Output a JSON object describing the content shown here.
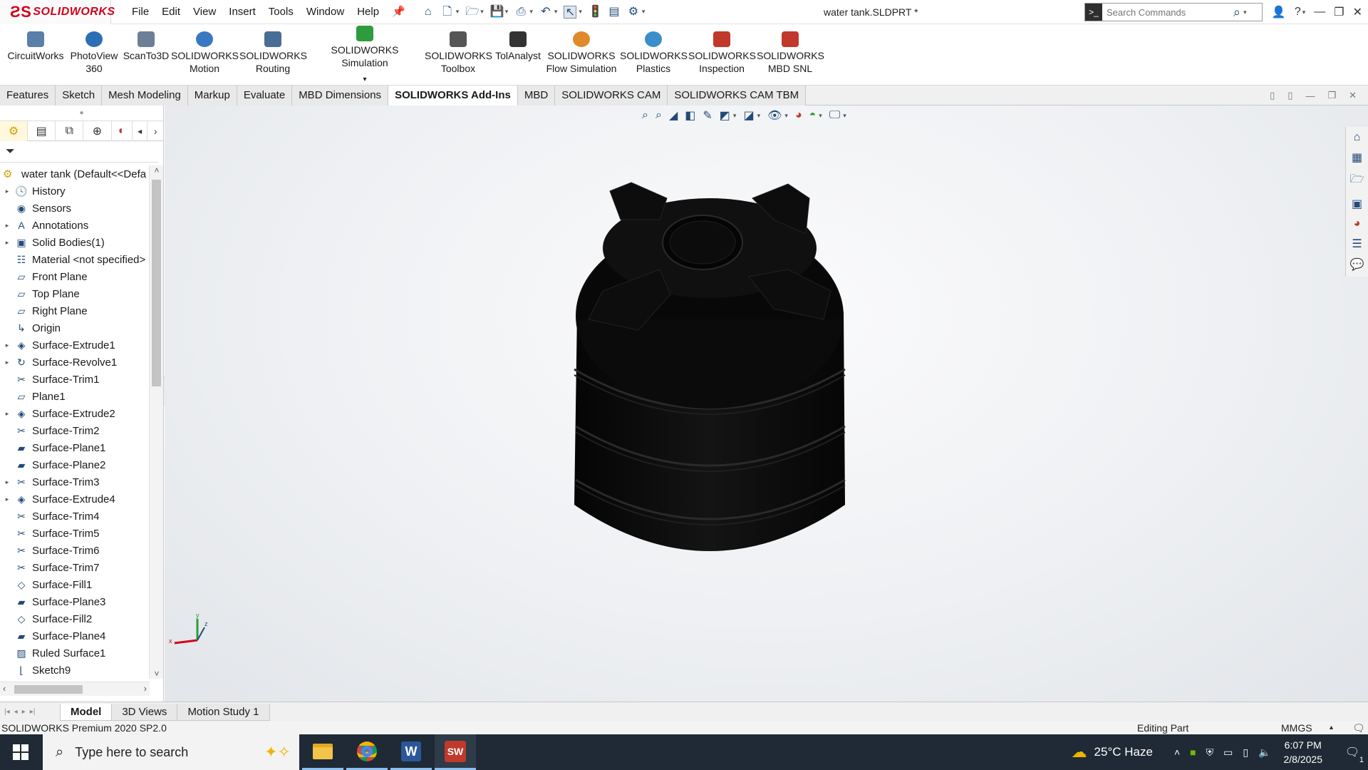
{
  "app": {
    "brand": "SOLIDWORKS",
    "document_title": "water tank.SLDPRT *"
  },
  "menu": [
    "File",
    "Edit",
    "View",
    "Insert",
    "Tools",
    "Window",
    "Help"
  ],
  "search": {
    "placeholder": "Search Commands"
  },
  "command_manager": [
    {
      "line1": "CircuitWorks",
      "line2": "",
      "icon": "circuitworks-icon",
      "color": "#5a7fa8"
    },
    {
      "line1": "PhotoView",
      "line2": "360",
      "icon": "photoview-icon",
      "color": "#2c6fb5"
    },
    {
      "line1": "ScanTo3D",
      "line2": "",
      "icon": "scanto3d-icon",
      "color": "#6d7f97"
    },
    {
      "line1": "SOLIDWORKS",
      "line2": "Motion",
      "icon": "motion-icon",
      "color": "#3a78c2"
    },
    {
      "line1": "SOLIDWORKS",
      "line2": "Routing",
      "icon": "routing-icon",
      "color": "#4a6d95"
    },
    {
      "line1": "SOLIDWORKS Simulation",
      "line2": "",
      "icon": "simulation-icon",
      "color": "#2e9c3e"
    },
    {
      "line1": "SOLIDWORKS",
      "line2": "Toolbox",
      "icon": "toolbox-icon",
      "color": "#555555"
    },
    {
      "line1": "TolAnalyst",
      "line2": "",
      "icon": "tolanalyst-icon",
      "color": "#333333"
    },
    {
      "line1": "SOLIDWORKS",
      "line2": "Flow Simulation",
      "icon": "flow-simulation-icon",
      "color": "#e08a2c"
    },
    {
      "line1": "SOLIDWORKS",
      "line2": "Plastics",
      "icon": "plastics-icon",
      "color": "#3a8ec9"
    },
    {
      "line1": "SOLIDWORKS",
      "line2": "Inspection",
      "icon": "inspection-icon",
      "color": "#c0392b"
    },
    {
      "line1": "SOLIDWORKS",
      "line2": "MBD SNL",
      "icon": "mbd-snl-icon",
      "color": "#c0392b"
    }
  ],
  "tabs": [
    "Features",
    "Sketch",
    "Mesh Modeling",
    "Markup",
    "Evaluate",
    "MBD Dimensions",
    "SOLIDWORKS Add-Ins",
    "MBD",
    "SOLIDWORKS CAM",
    "SOLIDWORKS CAM TBM"
  ],
  "active_tab": "SOLIDWORKS Add-Ins",
  "tree": {
    "root": "water tank  (Default<<Defa",
    "items": [
      {
        "label": "History",
        "icon": "history-icon",
        "expandable": true
      },
      {
        "label": "Sensors",
        "icon": "sensors-icon",
        "expandable": false
      },
      {
        "label": "Annotations",
        "icon": "annotations-icon",
        "expandable": true
      },
      {
        "label": "Solid Bodies(1)",
        "icon": "solid-bodies-icon",
        "expandable": true
      },
      {
        "label": "Material <not specified>",
        "icon": "material-icon",
        "expandable": false
      },
      {
        "label": "Front Plane",
        "icon": "plane-icon",
        "expandable": false
      },
      {
        "label": "Top Plane",
        "icon": "plane-icon",
        "expandable": false
      },
      {
        "label": "Right Plane",
        "icon": "plane-icon",
        "expandable": false
      },
      {
        "label": "Origin",
        "icon": "origin-icon",
        "expandable": false
      },
      {
        "label": "Surface-Extrude1",
        "icon": "surface-extrude-icon",
        "expandable": true
      },
      {
        "label": "Surface-Revolve1",
        "icon": "surface-revolve-icon",
        "expandable": true
      },
      {
        "label": "Surface-Trim1",
        "icon": "surface-trim-icon",
        "expandable": false
      },
      {
        "label": "Plane1",
        "icon": "plane-icon",
        "expandable": false
      },
      {
        "label": "Surface-Extrude2",
        "icon": "surface-extrude-icon",
        "expandable": true
      },
      {
        "label": "Surface-Trim2",
        "icon": "surface-trim-icon",
        "expandable": false
      },
      {
        "label": "Surface-Plane1",
        "icon": "surface-plane-icon",
        "expandable": false
      },
      {
        "label": "Surface-Plane2",
        "icon": "surface-plane-icon",
        "expandable": false
      },
      {
        "label": "Surface-Trim3",
        "icon": "surface-trim-icon",
        "expandable": true
      },
      {
        "label": "Surface-Extrude4",
        "icon": "surface-extrude-icon",
        "expandable": true
      },
      {
        "label": "Surface-Trim4",
        "icon": "surface-trim-icon",
        "expandable": false
      },
      {
        "label": "Surface-Trim5",
        "icon": "surface-trim-icon",
        "expandable": false
      },
      {
        "label": "Surface-Trim6",
        "icon": "surface-trim-icon",
        "expandable": false
      },
      {
        "label": "Surface-Trim7",
        "icon": "surface-trim-icon",
        "expandable": false
      },
      {
        "label": "Surface-Fill1",
        "icon": "surface-fill-icon",
        "expandable": false
      },
      {
        "label": "Surface-Plane3",
        "icon": "surface-plane-icon",
        "expandable": false
      },
      {
        "label": "Surface-Fill2",
        "icon": "surface-fill-icon",
        "expandable": false
      },
      {
        "label": "Surface-Plane4",
        "icon": "surface-plane-icon",
        "expandable": false
      },
      {
        "label": "Ruled Surface1",
        "icon": "ruled-surface-icon",
        "expandable": false
      },
      {
        "label": "Sketch9",
        "icon": "sketch-icon",
        "expandable": false
      }
    ]
  },
  "bottom_tabs": [
    "Model",
    "3D Views",
    "Motion Study 1"
  ],
  "active_bottom_tab": "Model",
  "status": {
    "product": "SOLIDWORKS Premium 2020 SP2.0",
    "mode": "Editing Part",
    "units": "MMGS"
  },
  "taskbar": {
    "search_placeholder": "Type here to search",
    "weather": "25°C  Haze",
    "time": "6:07 PM",
    "date": "2/8/2025",
    "notifications": "1",
    "apps": [
      "file-explorer-icon",
      "chrome-icon",
      "word-icon",
      "solidworks-icon"
    ]
  },
  "colors": {
    "brand_red": "#d0021b",
    "model": "#0c0c0c",
    "taskbar": "#1f2a36"
  }
}
